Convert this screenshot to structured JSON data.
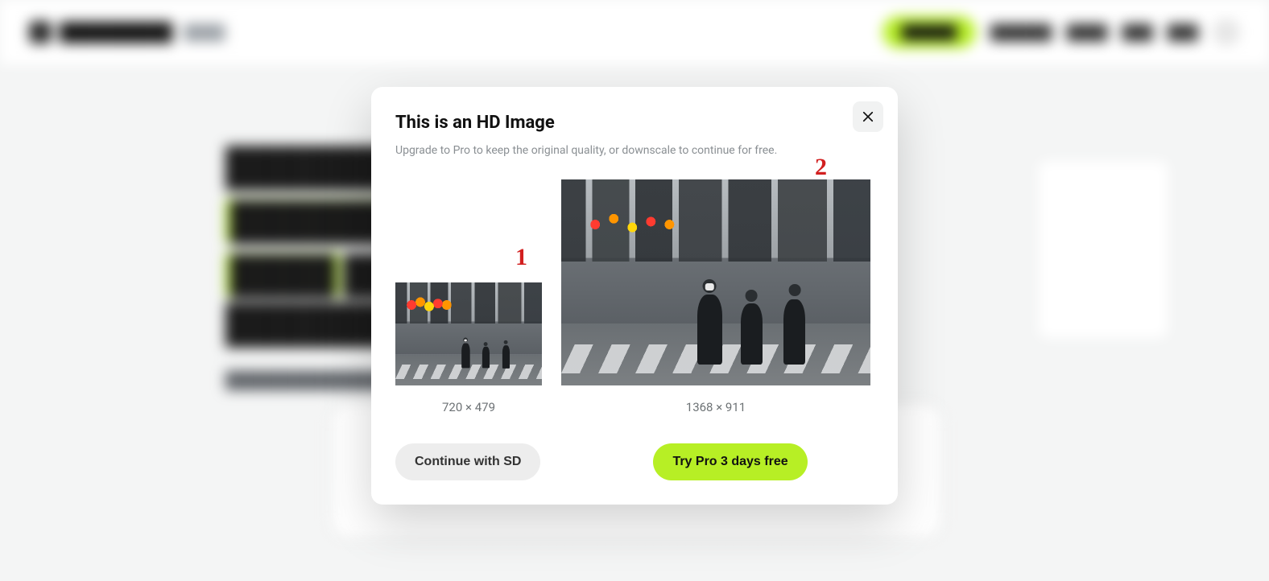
{
  "modal": {
    "title": "This is an HD Image",
    "subtitle": "Upgrade to Pro to keep the original quality, or downscale to continue for free.",
    "markers": {
      "small": "1",
      "large": "2"
    },
    "dims": {
      "small": "720 × 479",
      "large": "1368 × 911"
    },
    "secondary_label": "Continue with SD",
    "primary_label": "Try Pro 3 days free"
  }
}
